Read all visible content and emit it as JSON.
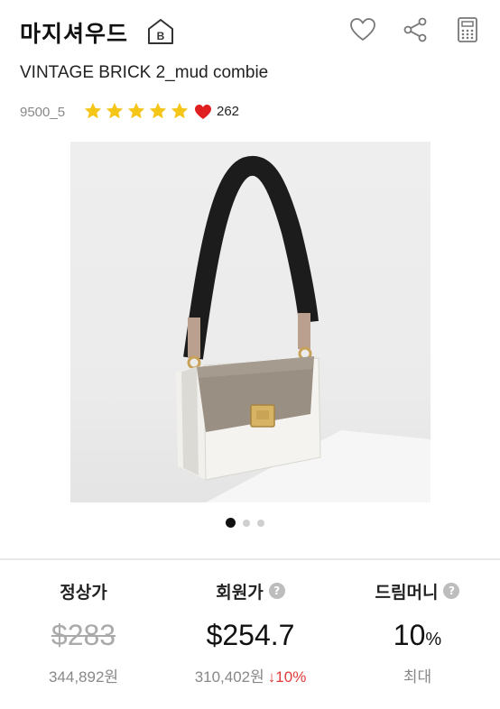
{
  "header": {
    "brand": "마지셔우드",
    "badge_letter": "B",
    "icons": [
      "heart-outline-icon",
      "share-icon",
      "calculator-icon"
    ]
  },
  "product": {
    "title": "VINTAGE BRICK 2_mud combie",
    "code": "9500_5",
    "rating_stars": 5,
    "likes": "262",
    "carousel": {
      "total": 3,
      "active": 1
    }
  },
  "pricing": {
    "regular": {
      "label": "정상가",
      "usd": "$283",
      "krw": "344,892원"
    },
    "member": {
      "label": "회원가",
      "usd": "$254.7",
      "krw": "310,402원",
      "discount": "↓10%"
    },
    "dream_money": {
      "label": "드림머니",
      "value": "10",
      "unit": "%",
      "note": "최대"
    }
  },
  "colors": {
    "star": "#f5c518",
    "heart": "#e02020",
    "discount": "#e23a3a",
    "image_bg": "#ececec"
  }
}
